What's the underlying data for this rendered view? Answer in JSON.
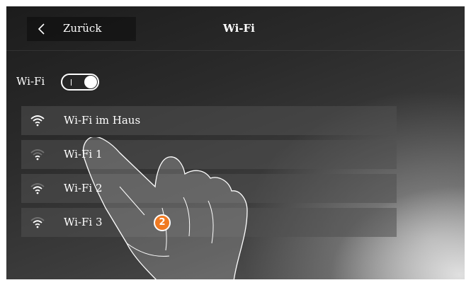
{
  "header": {
    "back_label": "Zurück",
    "title": "Wi-Fi"
  },
  "wifi_toggle": {
    "label": "Wi-Fi",
    "state": "on"
  },
  "networks": [
    {
      "name": "Wi-Fi im Haus",
      "icon": "wifi-strong-icon",
      "signal": "full"
    },
    {
      "name": "Wi-Fi 1",
      "icon": "wifi-weak-icon",
      "signal": "weak"
    },
    {
      "name": "Wi-Fi 2",
      "icon": "wifi-medium-icon",
      "signal": "medium"
    },
    {
      "name": "Wi-Fi 3",
      "icon": "wifi-medium-icon",
      "signal": "medium"
    }
  ],
  "callout": {
    "number": "2",
    "color": "#f07a22"
  },
  "colors": {
    "text": "#ffffff",
    "row_background": "#505050",
    "screen_background": "#2b2b2b"
  }
}
